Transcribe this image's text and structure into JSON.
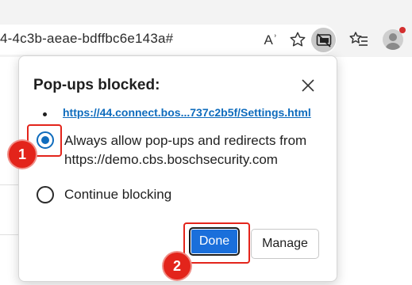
{
  "browser": {
    "url_fragment": "4-4c3b-aeae-bdffbc6e143a#",
    "read_aloud_label": "Aʾ",
    "icons": [
      "read-aloud-icon",
      "favorite-star-icon",
      "popup-blocked-icon",
      "favorites-icon",
      "profile-icon"
    ]
  },
  "dialog": {
    "title": "Pop-ups blocked:",
    "blocked_link": "https://44.connect.bos...737c2b5f/Settings.html",
    "options": [
      {
        "label": "Always allow pop-ups and redirects from https://demo.cbs.boschsecurity.com",
        "selected": true
      },
      {
        "label": "Continue blocking",
        "selected": false
      }
    ],
    "done_label": "Done",
    "manage_label": "Manage"
  },
  "annotations": {
    "step1": "1",
    "step2": "2",
    "color": "#e3241b"
  },
  "colors": {
    "accent": "#0f6cbd",
    "done_button": "#1a6fdb"
  }
}
